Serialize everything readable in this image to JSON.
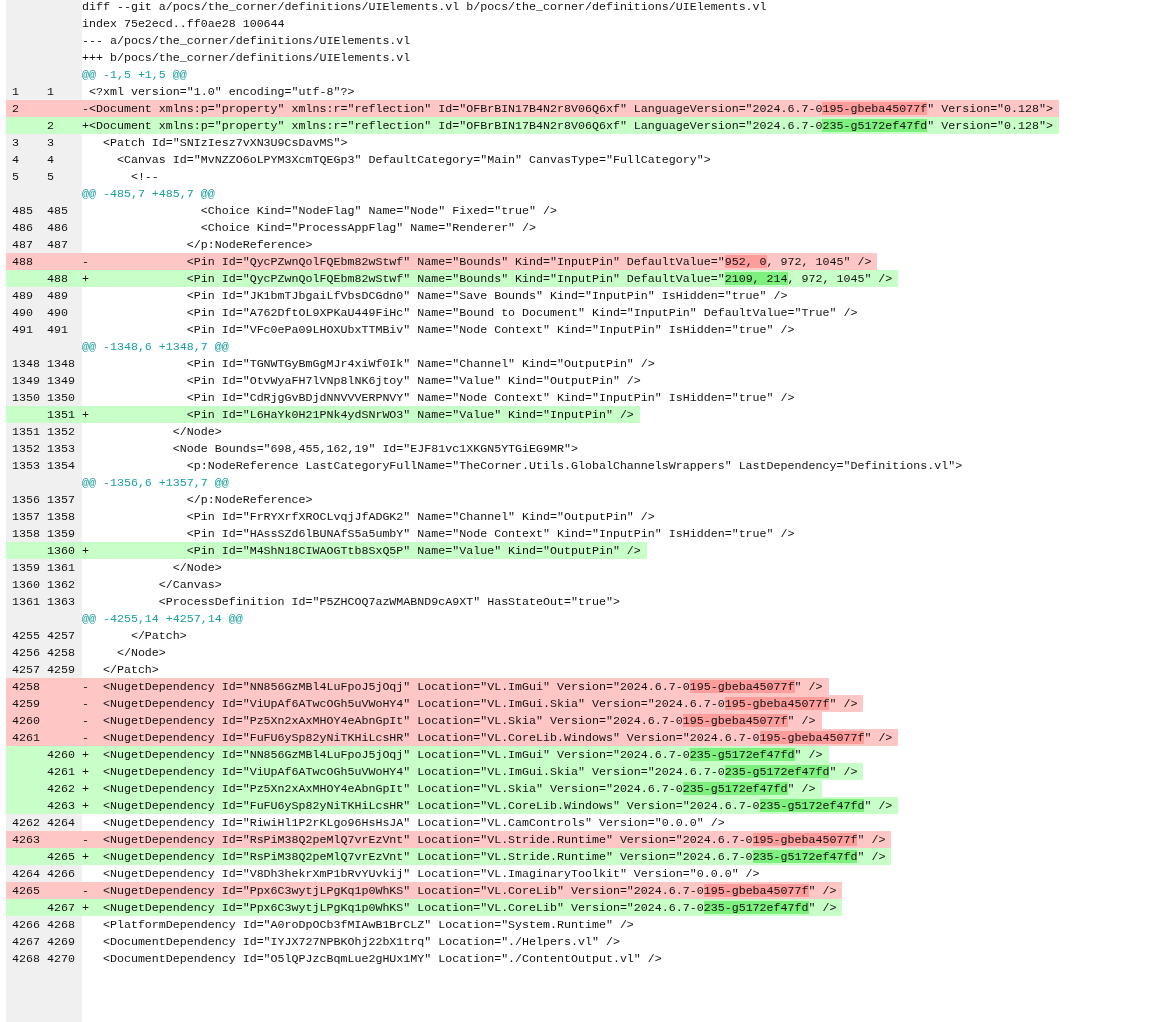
{
  "diff": {
    "lines": [
      {
        "kind": "meta",
        "text": "diff --git a/pocs/the_corner/definitions/UIElements.vl b/pocs/the_corner/definitions/UIElements.vl"
      },
      {
        "kind": "meta",
        "text": "index 75e2ecd..ff0ae28 100644"
      },
      {
        "kind": "meta",
        "text": "--- a/pocs/the_corner/definitions/UIElements.vl"
      },
      {
        "kind": "meta",
        "text": "+++ b/pocs/the_corner/definitions/UIElements.vl"
      },
      {
        "kind": "hunk",
        "text": "@@ -1,5 +1,5 @@"
      },
      {
        "kind": "context",
        "old": "1",
        "new": "1",
        "text": " <?xml version=\"1.0\" encoding=\"utf-8\"?>"
      },
      {
        "kind": "deleted",
        "old": "2",
        "parts": [
          {
            "text": "-<Document xmlns:p=\"property\" xmlns:r=\"reflection\" Id=\"OFBrBIN17B4N2r8V06Q6xf\" LanguageVersion=\"2024.6.7-0",
            "changed": false
          },
          {
            "text": "195-gbeba45077f",
            "changed": true
          },
          {
            "text": "\" Version=\"0.128\">",
            "changed": false
          }
        ]
      },
      {
        "kind": "added",
        "new": "2",
        "parts": [
          {
            "text": "+<Document xmlns:p=\"property\" xmlns:r=\"reflection\" Id=\"OFBrBIN17B4N2r8V06Q6xf\" LanguageVersion=\"2024.6.7-0",
            "changed": false
          },
          {
            "text": "235-g5172ef47fd",
            "changed": true
          },
          {
            "text": "\" Version=\"0.128\">",
            "changed": false
          }
        ]
      },
      {
        "kind": "context",
        "old": "3",
        "new": "3",
        "text": "   <Patch Id=\"SNIzIesz7vXN3U9CsDavMS\">"
      },
      {
        "kind": "context",
        "old": "4",
        "new": "4",
        "text": "     <Canvas Id=\"MvNZZO6oLPYM3XcmTQEGp3\" DefaultCategory=\"Main\" CanvasType=\"FullCategory\">"
      },
      {
        "kind": "context",
        "old": "5",
        "new": "5",
        "text": "       <!--"
      },
      {
        "kind": "hunk",
        "text": "@@ -485,7 +485,7 @@"
      },
      {
        "kind": "context",
        "old": "485",
        "new": "485",
        "text": "                 <Choice Kind=\"NodeFlag\" Name=\"Node\" Fixed=\"true\" />"
      },
      {
        "kind": "context",
        "old": "486",
        "new": "486",
        "text": "                 <Choice Kind=\"ProcessAppFlag\" Name=\"Renderer\" />"
      },
      {
        "kind": "context",
        "old": "487",
        "new": "487",
        "text": "               </p:NodeReference>"
      },
      {
        "kind": "deleted",
        "old": "488",
        "parts": [
          {
            "text": "-              <Pin Id=\"QycPZwnQolFQEbm82wStwf\" Name=\"Bounds\" Kind=\"InputPin\" DefaultValue=\"",
            "changed": false
          },
          {
            "text": "952, 0",
            "changed": true
          },
          {
            "text": ", 972, 1045\" />",
            "changed": false
          }
        ]
      },
      {
        "kind": "added",
        "new": "488",
        "parts": [
          {
            "text": "+              <Pin Id=\"QycPZwnQolFQEbm82wStwf\" Name=\"Bounds\" Kind=\"InputPin\" DefaultValue=\"",
            "changed": false
          },
          {
            "text": "2109, 214",
            "changed": true
          },
          {
            "text": ", 972, 1045\" />",
            "changed": false
          }
        ]
      },
      {
        "kind": "context",
        "old": "489",
        "new": "489",
        "text": "               <Pin Id=\"JK1bmTJbgaiLfVbsDCGdn0\" Name=\"Save Bounds\" Kind=\"InputPin\" IsHidden=\"true\" />"
      },
      {
        "kind": "context",
        "old": "490",
        "new": "490",
        "text": "               <Pin Id=\"A762DftOL9XPKaU449FiHc\" Name=\"Bound to Document\" Kind=\"InputPin\" DefaultValue=\"True\" />"
      },
      {
        "kind": "context",
        "old": "491",
        "new": "491",
        "text": "               <Pin Id=\"VFc0ePa09LHOXUbxTTMBiv\" Name=\"Node Context\" Kind=\"InputPin\" IsHidden=\"true\" />"
      },
      {
        "kind": "hunk",
        "text": "@@ -1348,6 +1348,7 @@"
      },
      {
        "kind": "context",
        "old": "1348",
        "new": "1348",
        "text": "               <Pin Id=\"TGNWTGyBmGgMJr4xiWf0Ik\" Name=\"Channel\" Kind=\"OutputPin\" />"
      },
      {
        "kind": "context",
        "old": "1349",
        "new": "1349",
        "text": "               <Pin Id=\"OtvWyaFH7lVNp8lNK6jtoy\" Name=\"Value\" Kind=\"OutputPin\" />"
      },
      {
        "kind": "context",
        "old": "1350",
        "new": "1350",
        "text": "               <Pin Id=\"CdRjgGvBDjdNNVVVERPNVY\" Name=\"Node Context\" Kind=\"InputPin\" IsHidden=\"true\" />"
      },
      {
        "kind": "added",
        "new": "1351",
        "text": "+              <Pin Id=\"L6HaYk0H21PNk4ydSNrWO3\" Name=\"Value\" Kind=\"InputPin\" />"
      },
      {
        "kind": "context",
        "old": "1351",
        "new": "1352",
        "text": "             </Node>"
      },
      {
        "kind": "context",
        "old": "1352",
        "new": "1353",
        "text": "             <Node Bounds=\"698,455,162,19\" Id=\"EJF81vc1XKGN5YTGiEG9MR\">"
      },
      {
        "kind": "context",
        "old": "1353",
        "new": "1354",
        "text": "               <p:NodeReference LastCategoryFullName=\"TheCorner.Utils.GlobalChannelsWrappers\" LastDependency=\"Definitions.vl\">"
      },
      {
        "kind": "hunk",
        "text": "@@ -1356,6 +1357,7 @@"
      },
      {
        "kind": "context",
        "old": "1356",
        "new": "1357",
        "text": "               </p:NodeReference>"
      },
      {
        "kind": "context",
        "old": "1357",
        "new": "1358",
        "text": "               <Pin Id=\"FrRYXrfXROCLvqjJfADGK2\" Name=\"Channel\" Kind=\"OutputPin\" />"
      },
      {
        "kind": "context",
        "old": "1358",
        "new": "1359",
        "text": "               <Pin Id=\"HAssSZd6lBUNAfS5a5umbY\" Name=\"Node Context\" Kind=\"InputPin\" IsHidden=\"true\" />"
      },
      {
        "kind": "added",
        "new": "1360",
        "text": "+              <Pin Id=\"M4ShN18CIWAOGTtb8SxQ5P\" Name=\"Value\" Kind=\"OutputPin\" />"
      },
      {
        "kind": "context",
        "old": "1359",
        "new": "1361",
        "text": "             </Node>"
      },
      {
        "kind": "context",
        "old": "1360",
        "new": "1362",
        "text": "           </Canvas>"
      },
      {
        "kind": "context",
        "old": "1361",
        "new": "1363",
        "text": "           <ProcessDefinition Id=\"P5ZHCOQ7azWMABND9cA9XT\" HasStateOut=\"true\">"
      },
      {
        "kind": "hunk",
        "text": "@@ -4255,14 +4257,14 @@"
      },
      {
        "kind": "context",
        "old": "4255",
        "new": "4257",
        "text": "       </Patch>"
      },
      {
        "kind": "context",
        "old": "4256",
        "new": "4258",
        "text": "     </Node>"
      },
      {
        "kind": "context",
        "old": "4257",
        "new": "4259",
        "text": "   </Patch>"
      },
      {
        "kind": "deleted",
        "old": "4258",
        "parts": [
          {
            "text": "-  <NugetDependency Id=\"NN856GzMBl4LuFpoJ5jOqj\" Location=\"VL.ImGui\" Version=\"2024.6.7-0",
            "changed": false
          },
          {
            "text": "195-gbeba45077f",
            "changed": true
          },
          {
            "text": "\" />",
            "changed": false
          }
        ]
      },
      {
        "kind": "deleted",
        "old": "4259",
        "parts": [
          {
            "text": "-  <NugetDependency Id=\"ViUpAf6ATwcOGh5uVWoHY4\" Location=\"VL.ImGui.Skia\" Version=\"2024.6.7-0",
            "changed": false
          },
          {
            "text": "195-gbeba45077f",
            "changed": true
          },
          {
            "text": "\" />",
            "changed": false
          }
        ]
      },
      {
        "kind": "deleted",
        "old": "4260",
        "parts": [
          {
            "text": "-  <NugetDependency Id=\"Pz5Xn2xAxMHOY4eAbnGpIt\" Location=\"VL.Skia\" Version=\"2024.6.7-0",
            "changed": false
          },
          {
            "text": "195-gbeba45077f",
            "changed": true
          },
          {
            "text": "\" />",
            "changed": false
          }
        ]
      },
      {
        "kind": "deleted",
        "old": "4261",
        "parts": [
          {
            "text": "-  <NugetDependency Id=\"FuFU6ySp82yNiTKHiLcsHR\" Location=\"VL.CoreLib.Windows\" Version=\"2024.6.7-0",
            "changed": false
          },
          {
            "text": "195-gbeba45077f",
            "changed": true
          },
          {
            "text": "\" />",
            "changed": false
          }
        ]
      },
      {
        "kind": "added",
        "new": "4260",
        "parts": [
          {
            "text": "+  <NugetDependency Id=\"NN856GzMBl4LuFpoJ5jOqj\" Location=\"VL.ImGui\" Version=\"2024.6.7-0",
            "changed": false
          },
          {
            "text": "235-g5172ef47fd",
            "changed": true
          },
          {
            "text": "\" />",
            "changed": false
          }
        ]
      },
      {
        "kind": "added",
        "new": "4261",
        "parts": [
          {
            "text": "+  <NugetDependency Id=\"ViUpAf6ATwcOGh5uVWoHY4\" Location=\"VL.ImGui.Skia\" Version=\"2024.6.7-0",
            "changed": false
          },
          {
            "text": "235-g5172ef47fd",
            "changed": true
          },
          {
            "text": "\" />",
            "changed": false
          }
        ]
      },
      {
        "kind": "added",
        "new": "4262",
        "parts": [
          {
            "text": "+  <NugetDependency Id=\"Pz5Xn2xAxMHOY4eAbnGpIt\" Location=\"VL.Skia\" Version=\"2024.6.7-0",
            "changed": false
          },
          {
            "text": "235-g5172ef47fd",
            "changed": true
          },
          {
            "text": "\" />",
            "changed": false
          }
        ]
      },
      {
        "kind": "added",
        "new": "4263",
        "parts": [
          {
            "text": "+  <NugetDependency Id=\"FuFU6ySp82yNiTKHiLcsHR\" Location=\"VL.CoreLib.Windows\" Version=\"2024.6.7-0",
            "changed": false
          },
          {
            "text": "235-g5172ef47fd",
            "changed": true
          },
          {
            "text": "\" />",
            "changed": false
          }
        ]
      },
      {
        "kind": "context",
        "old": "4262",
        "new": "4264",
        "text": "   <NugetDependency Id=\"RiwiHl1P2rKLgo96HsHsJA\" Location=\"VL.CamControls\" Version=\"0.0.0\" />"
      },
      {
        "kind": "deleted",
        "old": "4263",
        "parts": [
          {
            "text": "-  <NugetDependency Id=\"RsPiM38Q2peMlQ7vrEzVnt\" Location=\"VL.Stride.Runtime\" Version=\"2024.6.7-0",
            "changed": false
          },
          {
            "text": "195-gbeba45077f",
            "changed": true
          },
          {
            "text": "\" />",
            "changed": false
          }
        ]
      },
      {
        "kind": "added",
        "new": "4265",
        "parts": [
          {
            "text": "+  <NugetDependency Id=\"RsPiM38Q2peMlQ7vrEzVnt\" Location=\"VL.Stride.Runtime\" Version=\"2024.6.7-0",
            "changed": false
          },
          {
            "text": "235-g5172ef47fd",
            "changed": true
          },
          {
            "text": "\" />",
            "changed": false
          }
        ]
      },
      {
        "kind": "context",
        "old": "4264",
        "new": "4266",
        "text": "   <NugetDependency Id=\"V8Dh3hekrXmP1bRvYUvkij\" Location=\"VL.ImaginaryToolkit\" Version=\"0.0.0\" />"
      },
      {
        "kind": "deleted",
        "old": "4265",
        "parts": [
          {
            "text": "-  <NugetDependency Id=\"Ppx6C3wytjLPgKq1p0WhKS\" Location=\"VL.CoreLib\" Version=\"2024.6.7-0",
            "changed": false
          },
          {
            "text": "195-gbeba45077f",
            "changed": true
          },
          {
            "text": "\" />",
            "changed": false
          }
        ]
      },
      {
        "kind": "added",
        "new": "4267",
        "parts": [
          {
            "text": "+  <NugetDependency Id=\"Ppx6C3wytjLPgKq1p0WhKS\" Location=\"VL.CoreLib\" Version=\"2024.6.7-0",
            "changed": false
          },
          {
            "text": "235-g5172ef47fd",
            "changed": true
          },
          {
            "text": "\" />",
            "changed": false
          }
        ]
      },
      {
        "kind": "context",
        "old": "4266",
        "new": "4268",
        "text": "   <PlatformDependency Id=\"A0roDpOCb3fMIAwB1BrCLZ\" Location=\"System.Runtime\" />"
      },
      {
        "kind": "context",
        "old": "4267",
        "new": "4269",
        "text": "   <DocumentDependency Id=\"IYJX727NPBKOhj22bX1trq\" Location=\"./Helpers.vl\" />"
      },
      {
        "kind": "context",
        "old": "4268",
        "new": "4270",
        "text": "   <DocumentDependency Id=\"O5lQPJzcBqmLue2gHUx1MY\" Location=\"./ContentOutput.vl\" />"
      }
    ]
  }
}
